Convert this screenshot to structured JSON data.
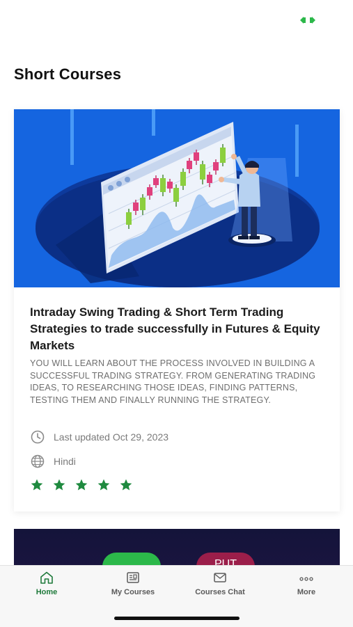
{
  "page": {
    "title": "Short Courses"
  },
  "course": {
    "title": "Intraday Swing Trading & Short Term Trading Strategies to trade successfully in Futures & Equity Markets",
    "description": "YOU WILL LEARN ABOUT THE PROCESS INVOLVED IN BUILDING A SUCCESSFUL TRADING STRATEGY. FROM GENERATING TRADING IDEAS, TO RESEARCHING THOSE IDEAS, FINDING PATTERNS, TESTING THEM AND FINALLY RUNNING THE STRATEGY.",
    "last_updated": "Last updated Oct 29, 2023",
    "language": "Hindi",
    "rating_stars": 5
  },
  "next_card": {
    "red_button_label": "PUT"
  },
  "tabbar": {
    "items": [
      {
        "label": "Home",
        "icon": "home-icon",
        "active": true
      },
      {
        "label": "My Courses",
        "icon": "courses-icon",
        "active": false
      },
      {
        "label": "Courses Chat",
        "icon": "mail-icon",
        "active": false
      },
      {
        "label": "More",
        "icon": "more-dots-icon",
        "active": false
      }
    ]
  },
  "colors": {
    "accent": "#1f7a3b",
    "star": "#1f8a3f",
    "hero_bg": "#1565e0"
  }
}
